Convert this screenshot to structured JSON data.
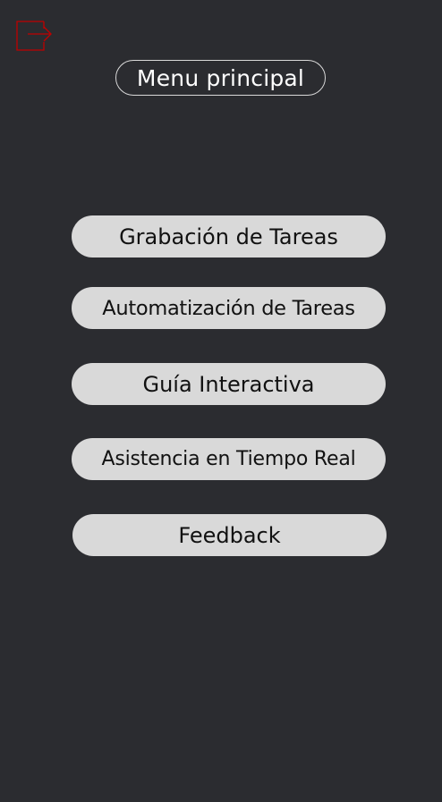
{
  "header": {
    "logout_icon": "logout-icon",
    "logout_icon_color": "#c00000",
    "title": "Menu principal"
  },
  "menu": {
    "items": [
      {
        "label": "Grabación de Tareas"
      },
      {
        "label": "Automatización de Tareas"
      },
      {
        "label": "Guía Interactiva"
      },
      {
        "label": "Asistencia en Tiempo Real"
      },
      {
        "label": "Feedback"
      }
    ]
  },
  "colors": {
    "background": "#2b2c30",
    "button_fill": "#d9d9d9",
    "button_text": "#111111",
    "title_text": "#ffffff",
    "accent_red": "#c00000"
  }
}
